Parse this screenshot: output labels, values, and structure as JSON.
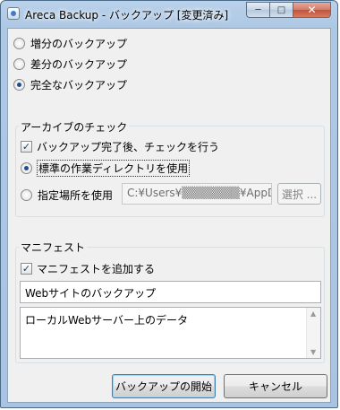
{
  "window": {
    "title": "Areca Backup - バックアップ [変更済み]",
    "controls": {
      "minimize": "─",
      "maximize": "□",
      "close": "✕"
    }
  },
  "backup_type": {
    "options": [
      {
        "label": "増分のバックアップ",
        "checked": false
      },
      {
        "label": "差分のバックアップ",
        "checked": false
      },
      {
        "label": "完全なバックアップ",
        "checked": true
      }
    ]
  },
  "archive_check": {
    "title": "アーカイブのチェック",
    "check_after_label": "バックアップ完了後、チェックを行う",
    "check_after_checked": true,
    "standard_dir_label": "標準の作業ディレクトリを使用",
    "standard_dir_checked": true,
    "custom_dir_label": "指定場所を使用",
    "custom_dir_checked": false,
    "custom_dir_value": "C:¥Users¥▒▒▒▒▒▒▒¥AppDa",
    "browse_label": "選択 ..."
  },
  "manifest": {
    "title": "マニフェスト",
    "add_label": "マニフェストを追加する",
    "add_checked": true,
    "title_value": "Webサイトのバックアップ",
    "description_value": "ローカルWebサーバー上のデータ"
  },
  "buttons": {
    "start": "バックアップの開始",
    "cancel": "キャンセル"
  },
  "colors": {
    "accent": "#3c7fb1",
    "window_frame": "#aec8e4"
  }
}
